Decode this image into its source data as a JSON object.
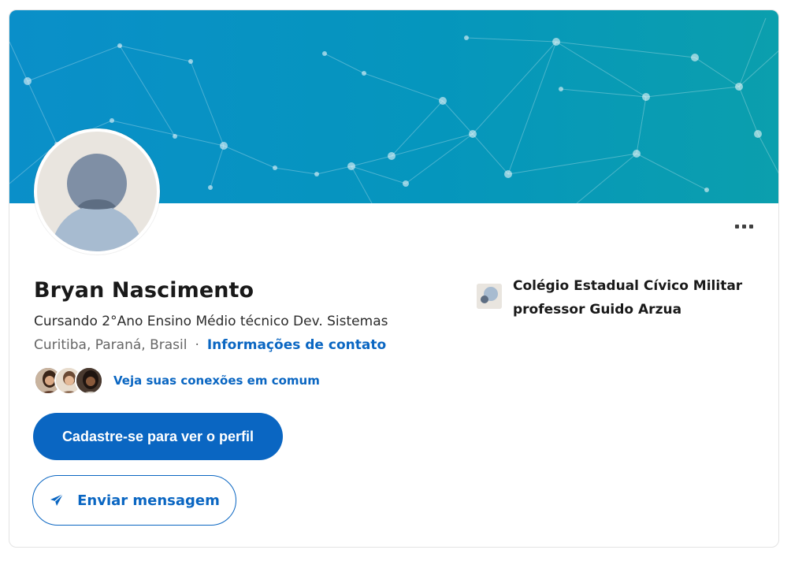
{
  "profile": {
    "name": "Bryan Nascimento",
    "headline": "Cursando 2°Ano Ensino Médio técnico Dev. Sistemas",
    "location": "Curitiba, Paraná, Brasil",
    "separator": "·",
    "contact_info_label": "Informações de contato",
    "connections_label": "Veja suas conexões em comum"
  },
  "actions": {
    "signup_label": "Cadastre-se para ver o perfil",
    "message_label": "Enviar mensagem",
    "more_icon": "ellipsis-icon"
  },
  "education": {
    "school_name": "Colégio Estadual Cívico Militar professor Guido Arzua"
  },
  "colors": {
    "accent": "#0a66c2",
    "cover_start": "#0a8fc9",
    "cover_end": "#0b9fad",
    "text_primary": "#191919",
    "text_muted": "#666666"
  }
}
